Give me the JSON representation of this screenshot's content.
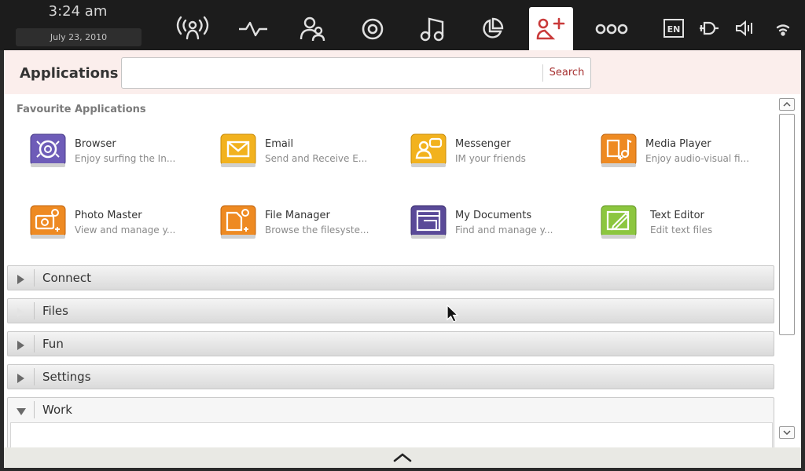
{
  "statusbar": {
    "time": "3:24 am",
    "date": "July 23, 2010",
    "nav_icons": [
      "status-icon",
      "activity-icon",
      "people-icon",
      "target-icon",
      "music-icon",
      "chart-icon",
      "applications-icon",
      "more-icon"
    ],
    "active_icon": "applications-icon",
    "tray": {
      "language": "EN",
      "icons": [
        "keyboard-language-icon",
        "battery-icon",
        "volume-icon",
        "wifi-icon"
      ]
    }
  },
  "header": {
    "title": "Applications",
    "search_value": "",
    "search_button": "Search"
  },
  "favourites": {
    "title": "Favourite Applications",
    "apps": [
      {
        "name": "Browser",
        "desc": "Enjoy surfing the In...",
        "icon": "browser-icon"
      },
      {
        "name": "Email",
        "desc": "Send and Receive E...",
        "icon": "email-icon"
      },
      {
        "name": "Messenger",
        "desc": "IM your friends",
        "icon": "messenger-icon"
      },
      {
        "name": "Media Player",
        "desc": "Enjoy audio-visual fi...",
        "icon": "media-player-icon"
      },
      {
        "name": "Photo Master",
        "desc": "View and manage y...",
        "icon": "photo-master-icon"
      },
      {
        "name": "File Manager",
        "desc": "Browse the filesyste...",
        "icon": "file-manager-icon"
      },
      {
        "name": "My Documents",
        "desc": "Find and manage y...",
        "icon": "my-documents-icon"
      },
      {
        "name": "Text Editor",
        "desc": "Edit text files",
        "icon": "text-editor-icon"
      }
    ]
  },
  "categories": [
    {
      "label": "Connect",
      "expanded": false
    },
    {
      "label": "Files",
      "expanded": false
    },
    {
      "label": "Fun",
      "expanded": false
    },
    {
      "label": "Settings",
      "expanded": false
    },
    {
      "label": "Work",
      "expanded": true
    }
  ],
  "colors": {
    "topbar": "#1c1c1c",
    "accent": "#c93a3a",
    "header_tint": "#fbeeec",
    "browser": "#6e5cb8",
    "email": "#f2b21e",
    "messenger": "#f2b21e",
    "media_player": "#ee8a22",
    "photo_master": "#ee8a22",
    "file_manager": "#ee8a22",
    "my_documents": "#5a4a98",
    "text_editor": "#8cc63f"
  }
}
